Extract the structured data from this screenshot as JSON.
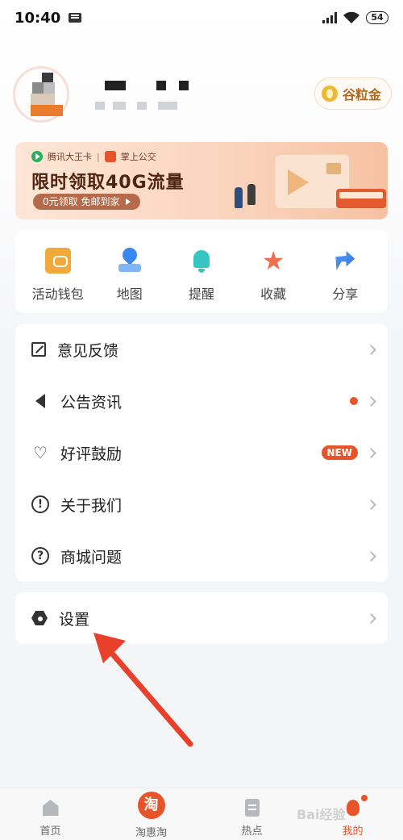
{
  "status_bar": {
    "time": "10:40",
    "battery": "54"
  },
  "profile": {
    "grain_label": "谷粒金"
  },
  "banner": {
    "brand1": "腾讯大王卡",
    "separator": "|",
    "brand2": "掌上公交",
    "title": "限时领取40G流量",
    "pill_text": "0元领取 免邮到家"
  },
  "quick_actions": [
    {
      "label": "活动钱包",
      "icon": "wallet-icon"
    },
    {
      "label": "地图",
      "icon": "map-pin-icon"
    },
    {
      "label": "提醒",
      "icon": "bell-icon"
    },
    {
      "label": "收藏",
      "icon": "star-icon"
    },
    {
      "label": "分享",
      "icon": "share-arrow-icon"
    }
  ],
  "menu": [
    {
      "label": "意见反馈",
      "icon": "edit-icon"
    },
    {
      "label": "公告资讯",
      "icon": "speaker-icon",
      "indicator": "dot"
    },
    {
      "label": "好评鼓励",
      "icon": "heart-icon",
      "badge": "NEW"
    },
    {
      "label": "关于我们",
      "icon": "info-icon"
    },
    {
      "label": "商城问题",
      "icon": "question-icon"
    }
  ],
  "settings": {
    "label": "设置",
    "icon": "settings-hex-icon"
  },
  "tab_bar": [
    {
      "label": "首页",
      "icon": "home-icon"
    },
    {
      "label": "淘惠淘",
      "icon": "tao-logo-icon",
      "glyph": "淘"
    },
    {
      "label": "热点",
      "icon": "news-icon"
    },
    {
      "label": "我的",
      "icon": "mine-icon",
      "active": true
    }
  ],
  "watermark": "Bai经验",
  "colors": {
    "accent": "#e8542a",
    "background": "#f4f5f7",
    "card": "#ffffff"
  }
}
